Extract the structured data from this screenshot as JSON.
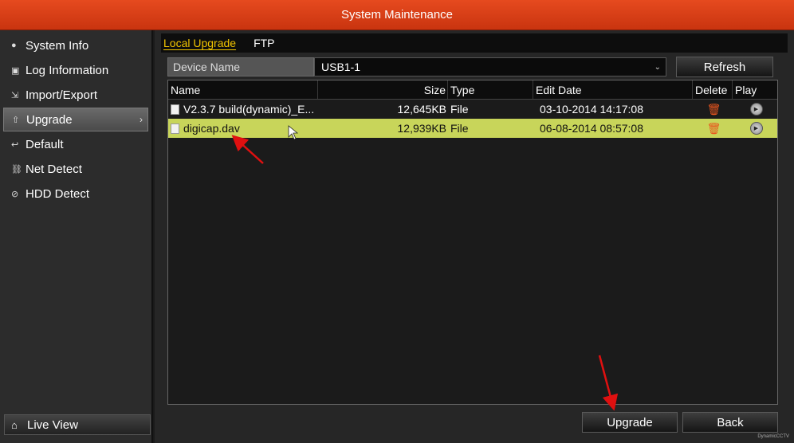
{
  "window": {
    "title": "System Maintenance"
  },
  "sidebar": {
    "items": [
      {
        "label": "System Info",
        "icon": "info-icon"
      },
      {
        "label": "Log Information",
        "icon": "log-icon"
      },
      {
        "label": "Import/Export",
        "icon": "import-export-icon"
      },
      {
        "label": "Upgrade",
        "icon": "upgrade-icon",
        "active": true
      },
      {
        "label": "Default",
        "icon": "default-icon"
      },
      {
        "label": "Net Detect",
        "icon": "network-icon"
      },
      {
        "label": "HDD Detect",
        "icon": "hdd-icon"
      }
    ],
    "live_view_label": "Live View"
  },
  "tabs": [
    {
      "label": "Local Upgrade",
      "active": true
    },
    {
      "label": "FTP",
      "active": false
    }
  ],
  "device": {
    "label": "Device Name",
    "value": "USB1-1"
  },
  "buttons": {
    "refresh": "Refresh",
    "upgrade": "Upgrade",
    "back": "Back"
  },
  "table": {
    "headers": {
      "name": "Name",
      "size": "Size",
      "type": "Type",
      "date": "Edit Date",
      "delete": "Delete",
      "play": "Play"
    },
    "rows": [
      {
        "name": "V2.3.7 build(dynamic)_E...",
        "size": "12,645KB",
        "type": "File",
        "date": "03-10-2014 14:17:08"
      },
      {
        "name": "digicap.dav",
        "size": "12,939KB",
        "type": "File",
        "date": "06-08-2014 08:57:08",
        "selected": true
      }
    ]
  },
  "watermark": "DynamicCCTV",
  "colors": {
    "title_bar": "#d63c14",
    "selected_row": "#c8d55a",
    "active_tab": "#f2c400",
    "annotation_arrow": "#e01010"
  }
}
